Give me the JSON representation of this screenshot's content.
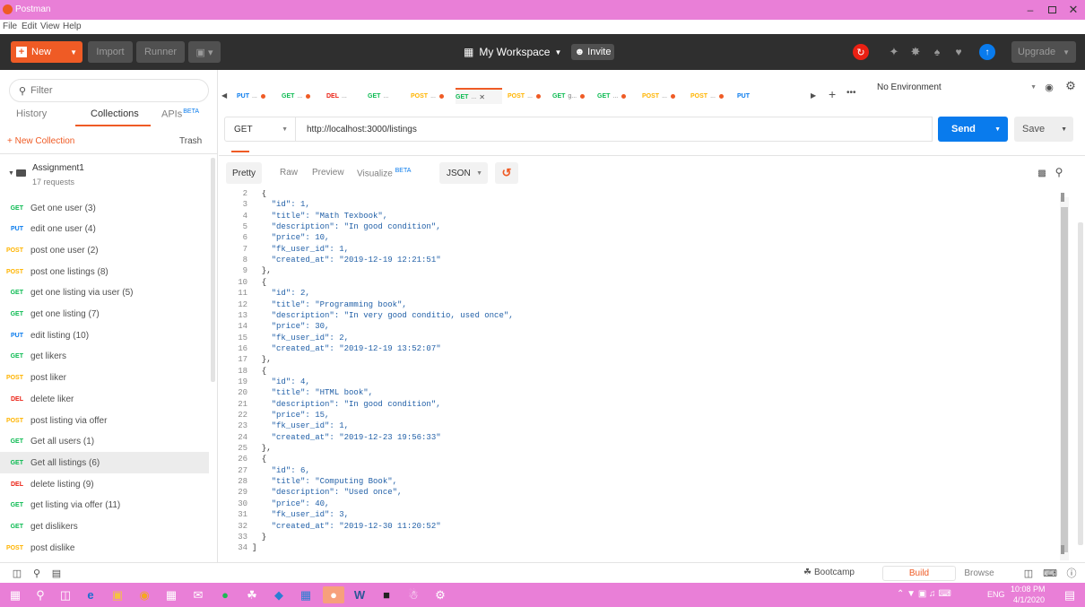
{
  "window": {
    "title": "Postman",
    "menu": [
      "File",
      "Edit",
      "View",
      "Help"
    ]
  },
  "toolbar": {
    "new_label": "New",
    "import_label": "Import",
    "runner_label": "Runner",
    "workspace_label": "My Workspace",
    "invite_label": "Invite",
    "upgrade_label": "Upgrade"
  },
  "sidebar": {
    "filter_placeholder": "Filter",
    "tabs": [
      {
        "label": "History"
      },
      {
        "label": "Collections"
      },
      {
        "label": "APIs"
      }
    ],
    "apis_badge": "BETA",
    "new_collection": "+ New Collection",
    "trash": "Trash",
    "collection": {
      "name": "Assignment1",
      "count": "17 requests"
    },
    "requests": [
      {
        "method": "GET",
        "name": "Get one user (3)"
      },
      {
        "method": "PUT",
        "name": "edit one user (4)"
      },
      {
        "method": "POST",
        "name": "post one user (2)"
      },
      {
        "method": "POST",
        "name": "post one listings (8)"
      },
      {
        "method": "GET",
        "name": "get one listing via user (5)"
      },
      {
        "method": "GET",
        "name": "get one listing (7)"
      },
      {
        "method": "PUT",
        "name": "edit listing (10)"
      },
      {
        "method": "GET",
        "name": "get likers"
      },
      {
        "method": "POST",
        "name": "post liker"
      },
      {
        "method": "DEL",
        "name": "delete liker"
      },
      {
        "method": "POST",
        "name": "post listing via offer"
      },
      {
        "method": "GET",
        "name": "Get all users (1)"
      },
      {
        "method": "GET",
        "name": "Get all listings (6)"
      },
      {
        "method": "DEL",
        "name": "delete listing (9)"
      },
      {
        "method": "GET",
        "name": "get listing via offer (11)"
      },
      {
        "method": "GET",
        "name": "get dislikers"
      },
      {
        "method": "POST",
        "name": "post dislike"
      }
    ]
  },
  "tabs": [
    {
      "method": "PUT",
      "label": "...",
      "dot": true
    },
    {
      "method": "GET",
      "label": "...",
      "dot": true
    },
    {
      "method": "DEL",
      "label": "...",
      "dot": false
    },
    {
      "method": "GET",
      "label": "...",
      "dot": false
    },
    {
      "method": "POST",
      "label": "...",
      "dot": true
    },
    {
      "method": "GET",
      "label": "...",
      "close": true
    },
    {
      "method": "POST",
      "label": "...",
      "dot": true
    },
    {
      "method": "GET",
      "label": "g...",
      "dot": true
    },
    {
      "method": "GET",
      "label": "...",
      "dot": true
    },
    {
      "method": "POST",
      "label": "...",
      "dot": true
    },
    {
      "method": "POST",
      "label": "...",
      "dot": true
    },
    {
      "method": "PUT",
      "label": "",
      "dot": false
    }
  ],
  "environment": {
    "label": "No Environment"
  },
  "request": {
    "method": "GET",
    "url": "http://localhost:3000/listings",
    "send_label": "Send",
    "save_label": "Save"
  },
  "response": {
    "views": [
      "Pretty",
      "Raw",
      "Preview",
      "Visualize"
    ],
    "visualize_badge": "BETA",
    "format": "JSON"
  },
  "code_lines": [
    {
      "n": "2",
      "t": "  {"
    },
    {
      "n": "3",
      "t": "    \"id\": 1,"
    },
    {
      "n": "4",
      "t": "    \"title\": \"Math Texbook\","
    },
    {
      "n": "5",
      "t": "    \"description\": \"In good condition\","
    },
    {
      "n": "6",
      "t": "    \"price\": 10,"
    },
    {
      "n": "7",
      "t": "    \"fk_user_id\": 1,"
    },
    {
      "n": "8",
      "t": "    \"created_at\": \"2019-12-19 12:21:51\""
    },
    {
      "n": "9",
      "t": "  },"
    },
    {
      "n": "10",
      "t": "  {"
    },
    {
      "n": "11",
      "t": "    \"id\": 2,"
    },
    {
      "n": "12",
      "t": "    \"title\": \"Programming book\","
    },
    {
      "n": "13",
      "t": "    \"description\": \"In very good conditio, used once\","
    },
    {
      "n": "14",
      "t": "    \"price\": 30,"
    },
    {
      "n": "15",
      "t": "    \"fk_user_id\": 2,"
    },
    {
      "n": "16",
      "t": "    \"created_at\": \"2019-12-19 13:52:07\""
    },
    {
      "n": "17",
      "t": "  },"
    },
    {
      "n": "18",
      "t": "  {"
    },
    {
      "n": "19",
      "t": "    \"id\": 4,"
    },
    {
      "n": "20",
      "t": "    \"title\": \"HTML book\","
    },
    {
      "n": "21",
      "t": "    \"description\": \"In good condition\","
    },
    {
      "n": "22",
      "t": "    \"price\": 15,"
    },
    {
      "n": "23",
      "t": "    \"fk_user_id\": 1,"
    },
    {
      "n": "24",
      "t": "    \"created_at\": \"2019-12-23 19:56:33\""
    },
    {
      "n": "25",
      "t": "  },"
    },
    {
      "n": "26",
      "t": "  {"
    },
    {
      "n": "27",
      "t": "    \"id\": 6,"
    },
    {
      "n": "28",
      "t": "    \"title\": \"Computing Book\","
    },
    {
      "n": "29",
      "t": "    \"description\": \"Used once\","
    },
    {
      "n": "30",
      "t": "    \"price\": 40,"
    },
    {
      "n": "31",
      "t": "    \"fk_user_id\": 3,"
    },
    {
      "n": "32",
      "t": "    \"created_at\": \"2019-12-30 11:20:52\""
    },
    {
      "n": "33",
      "t": "  }"
    },
    {
      "n": "34",
      "t": "]"
    }
  ],
  "statusbar": {
    "bootcamp": "Bootcamp",
    "build": "Build",
    "browse": "Browse"
  },
  "taskbar": {
    "lang": "ENG",
    "time": "10:08 PM",
    "date": "4/1/2020"
  },
  "colors": {
    "accent": "#ef5b25",
    "send": "#097bed",
    "get": "#0cbb52",
    "post": "#ffb400",
    "put": "#097bed",
    "del": "#eb2013",
    "titlebar": "#e97fd7"
  }
}
